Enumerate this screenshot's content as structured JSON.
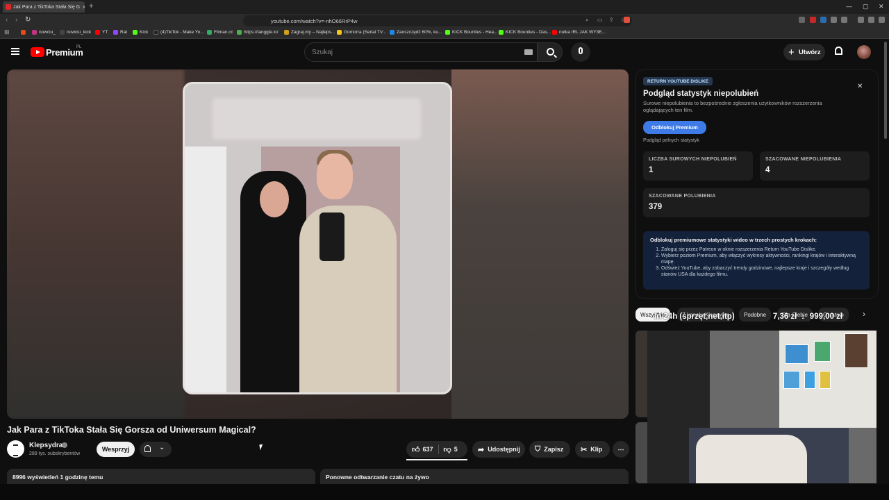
{
  "browser": {
    "tab_title": "Jak Para z TikToka Stała Się G",
    "url": "youtube.com/watch?v=-nhO66RrP4w",
    "bookmarks": [
      "nowciu_",
      "nowciu_kick",
      "YT",
      "Rat",
      "Kick",
      "(4)TikTok - Make Yo...",
      "Filman.cc",
      "https://tanggle.io/",
      "Zagraj.my – Najleps...",
      "Gomorra (Serial TV...",
      "Zaoszczędź 60%, ku...",
      "KICK Bounties - Hea...",
      "KICK Bounties - Das...",
      "nutka IRL JAK WY3E..."
    ]
  },
  "youtube": {
    "logo_text": "Premium",
    "logo_region": "PL",
    "search_placeholder": "Szukaj",
    "create_label": "Utwórz"
  },
  "video": {
    "title": "Jak Para z TikToka Stała Się Gorsza od Uniwersum Magical?",
    "channel": "Klepsydra",
    "subscribers": "289 tys. subskrybentów",
    "support_label": "Wesprzyj",
    "likes": "637",
    "dislikes": "5",
    "share_label": "Udostępnij",
    "save_label": "Zapisz",
    "clip_label": "Klip",
    "views_meta": "8996 wyświetleń  1 godzinę temu",
    "chat_replay": "Ponowne odtwarzanie czatu na żywo"
  },
  "ryd": {
    "badge": "RETURN YOUTUBE DISLIKE",
    "title": "Podgląd statystyk niepolubień",
    "description": "Surowe niepolubienia to bezpośrednie zgłoszenia użytkowników rozszerzenia oglądających ten film.",
    "unlock_label": "Odblokuj Premium",
    "preview_label": "Podgląd pełnych statystyk",
    "stats": [
      {
        "label": "LICZBA SUROWYCH NIEPOLUBIEŃ",
        "value": "1"
      },
      {
        "label": "SZACOWANE NIEPOLUBIENIA",
        "value": "4"
      },
      {
        "label": "SZACOWANE POLUBIENIA",
        "value": "379"
      }
    ],
    "promo_heading": "Odblokuj premiumowe statystyki wideo w trzech prostych krokach:",
    "promo_steps": [
      "Zaloguj się przez Patreon w oknie rozszerzenia Return YouTube Dislike.",
      "Wybierz poziom Premium, aby włączyć wykresy aktywności, rankingi krajów i interaktywną mapę.",
      "Odśwież YouTube, aby zobaczyć trendy godzinowe, najlepsze kraje i szczegóły według stanów USA dla każdego filmu."
    ]
  },
  "chips": [
    "Wszystkie",
    "Z kanału Klepsydra",
    "Podobne",
    "Dla Ciebie",
    "Ostatnio"
  ],
  "overlay": {
    "text_left": "In 24h (sprzęt,net,itp)",
    "text_mid": "7,36 zł",
    "text_z": "z",
    "text_right": "999,00 zł"
  }
}
